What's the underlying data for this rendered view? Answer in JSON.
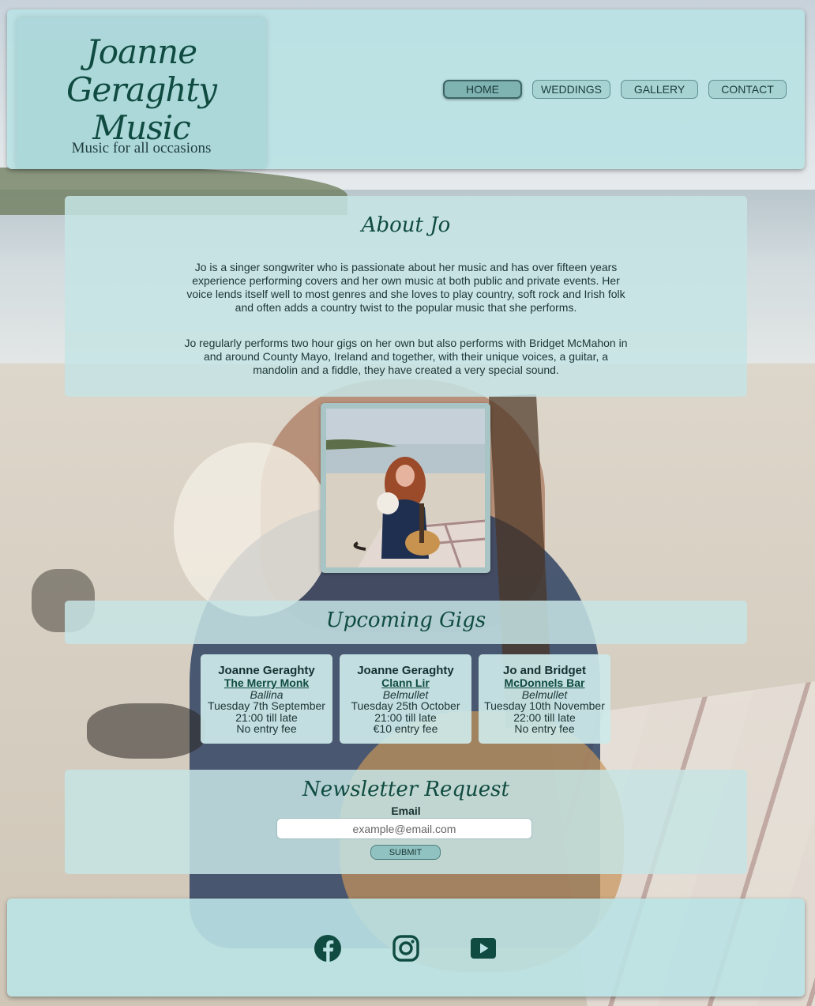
{
  "header": {
    "logo_title": "Joanne Geraghty Music",
    "tagline": "Music for all occasions",
    "nav": [
      {
        "label": "HOME",
        "active": true
      },
      {
        "label": "WEDDINGS",
        "active": false
      },
      {
        "label": "GALLERY",
        "active": false
      },
      {
        "label": "CONTACT",
        "active": false
      }
    ]
  },
  "about": {
    "heading": "About Jo",
    "paragraph1": "Jo is a singer songwriter who is passionate about her music and has over fifteen years experience performing covers and her own music at both public and private events. Her voice lends itself well to most genres and she loves to play country, soft rock and Irish folk and often adds a country twist to the popular music that she performs.",
    "paragraph2": "Jo regularly performs two hour gigs on her own but also performs with Bridget McMahon in and around County Mayo, Ireland and together, with their unique voices, a guitar, a mandolin and a fiddle, they have created a very special sound."
  },
  "gigs": {
    "heading": "Upcoming Gigs",
    "items": [
      {
        "artist": "Joanne Geraghty",
        "venue": "The Merry Monk",
        "town": "Ballina",
        "date": "Tuesday 7th September",
        "time": "21:00 till late",
        "fee": "No entry fee"
      },
      {
        "artist": "Joanne Geraghty",
        "venue": "Clann Lir",
        "town": "Belmullet",
        "date": "Tuesday 25th October",
        "time": "21:00 till late",
        "fee": "€10 entry fee"
      },
      {
        "artist": "Jo and Bridget",
        "venue": "McDonnels Bar",
        "town": "Belmullet",
        "date": "Tuesday 10th November",
        "time": "22:00 till late",
        "fee": "No entry fee"
      }
    ]
  },
  "newsletter": {
    "heading": "Newsletter Request",
    "email_label": "Email",
    "email_placeholder": "example@email.com",
    "email_value": "",
    "submit_label": "SUBMIT"
  },
  "footer": {
    "social": [
      {
        "icon": "facebook-icon"
      },
      {
        "icon": "instagram-icon"
      },
      {
        "icon": "youtube-icon"
      }
    ]
  },
  "colors": {
    "accent_dark": "#0f4b40",
    "panel": "#c6e4e4",
    "header": "#bae2e4"
  }
}
